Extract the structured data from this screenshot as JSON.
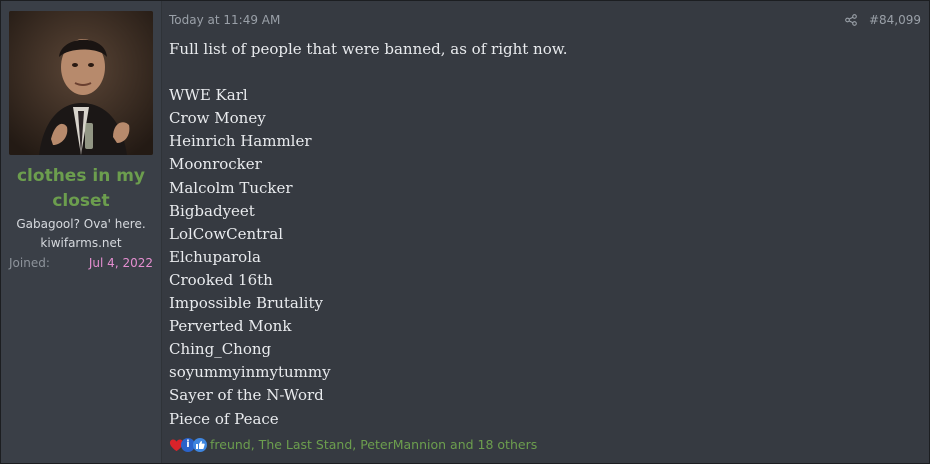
{
  "post": {
    "author": {
      "username": "clothes in my closet",
      "title": "Gabagool? Ova' here.",
      "banner": "kiwifarms.net",
      "joined_label": "Joined:",
      "joined_date": "Jul 4, 2022"
    },
    "timestamp": "Today at 11:49 AM",
    "post_number": "#84,099",
    "message_lines": [
      "Full list of people that were banned, as of right now.",
      "",
      "WWE Karl",
      "Crow Money",
      "Heinrich Hammler",
      "Moonrocker",
      "Malcolm Tucker",
      "Bigbadyeet",
      "LolCowCentral",
      "Elchuparola",
      "Crooked 16th",
      "Impossible Brutality",
      "Perverted Monk",
      "Ching_Chong",
      "soyummyinmytummy",
      "Sayer of the N-Word",
      "Piece of Peace"
    ],
    "reactions": {
      "icons": [
        "heart-icon",
        "informative-icon",
        "like-icon"
      ],
      "summary": "freund, The Last Stand, PeterMannion and 18 others"
    }
  },
  "colors": {
    "username": "#6c9e4e",
    "joined_date": "#e48ed0",
    "background": "#363a41"
  }
}
